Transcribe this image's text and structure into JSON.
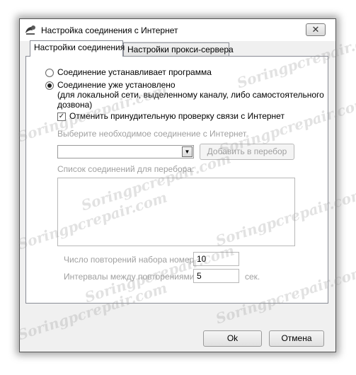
{
  "window": {
    "title": "Настройка соединения с Интернет",
    "close_glyph": "✕"
  },
  "tabs": [
    {
      "label": "Настройки соединения",
      "active": true
    },
    {
      "label": "Настройки прокси-сервера",
      "active": false
    }
  ],
  "connection": {
    "option_program": "Соединение устанавливает программа",
    "option_established": "Соединение уже установлено",
    "option_established_note": "(для локальной сети, выделенному каналу, либо самостоятельного дозвона)",
    "option_established_note_line1": "(для локальной сети, выделенному каналу, либо самостоятельного",
    "option_established_note_line2": "дозвона)",
    "selected_option": "established",
    "cancel_check_label": "Отменить принудительную проверку связи с Интернет",
    "cancel_check_checked": true,
    "check_glyph": "✓"
  },
  "dialup": {
    "select_label": "Выберите необходимое соединение с Интернет",
    "select_value": "",
    "arrow_glyph": "▼",
    "add_button": "Добавить в перебор",
    "list_label": "Список соединений для перебора:",
    "list_items": [],
    "retries_label": "Число повторений набора номера:",
    "retries_value": "10",
    "interval_label": "Интервалы между повторениями:",
    "interval_value": "5",
    "interval_unit": "сек."
  },
  "buttons": {
    "ok": "Ok",
    "cancel": "Отмена"
  },
  "watermark_text": "Soringpcrepair.com"
}
